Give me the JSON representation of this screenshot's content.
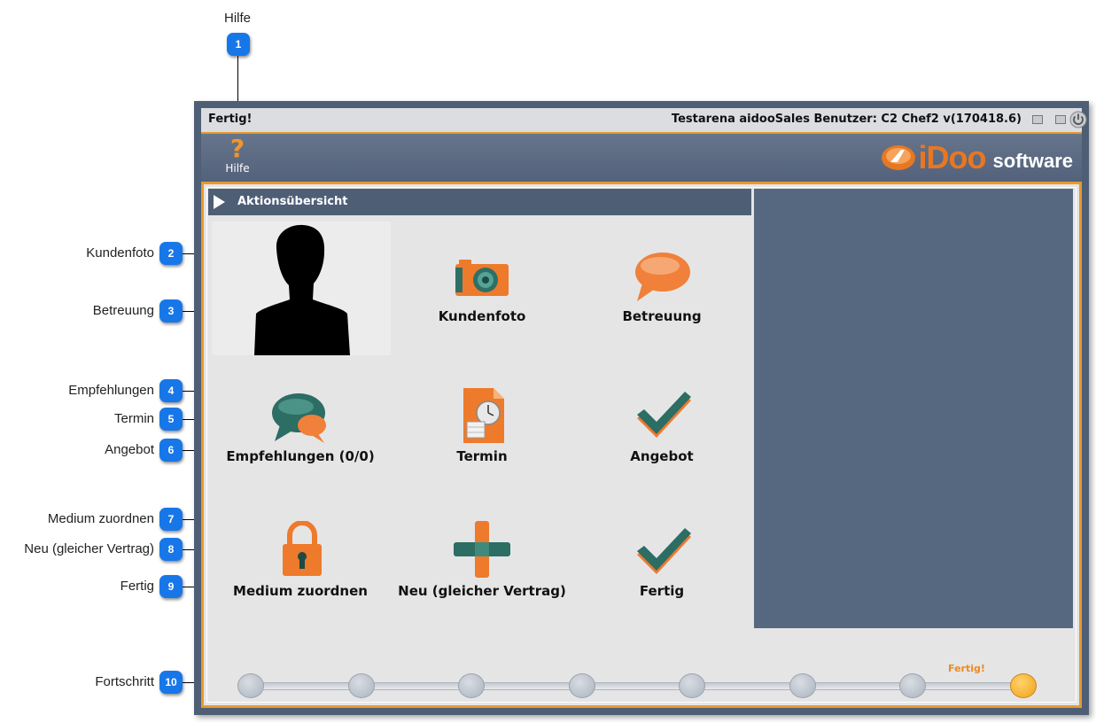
{
  "callouts": [
    {
      "num": "1",
      "label": "Hilfe"
    },
    {
      "num": "2",
      "label": "Kundenfoto"
    },
    {
      "num": "3",
      "label": "Betreuung"
    },
    {
      "num": "4",
      "label": "Empfehlungen"
    },
    {
      "num": "5",
      "label": "Termin"
    },
    {
      "num": "6",
      "label": "Angebot"
    },
    {
      "num": "7",
      "label": "Medium zuordnen"
    },
    {
      "num": "8",
      "label": "Neu (gleicher Vertrag)"
    },
    {
      "num": "9",
      "label": "Fertig"
    },
    {
      "num": "10",
      "label": "Fortschritt"
    }
  ],
  "titlebar": {
    "status": "Fertig!",
    "title": "Testarena aidooSales Benutzer: C2 Chef2 v(170418.6)"
  },
  "toolbar": {
    "help_label": "Hilfe",
    "help_glyph": "?",
    "logo_text_1": "iDoo",
    "logo_text_2": "software"
  },
  "panel": {
    "header": "Aktionsübersicht",
    "actions": {
      "kundenfoto": "Kundenfoto",
      "betreuung": "Betreuung",
      "empfehlungen": "Empfehlungen (0/0)",
      "termin": "Termin",
      "angebot": "Angebot",
      "medium": "Medium zuordnen",
      "neu": "Neu (gleicher Vertrag)",
      "fertig": "Fertig"
    }
  },
  "progress": {
    "label": "Fertig!",
    "steps_total": 8,
    "active_step": 8
  },
  "colors": {
    "accent": "#e69a2e",
    "panel": "#4e5e75",
    "badge": "#1877e8"
  }
}
